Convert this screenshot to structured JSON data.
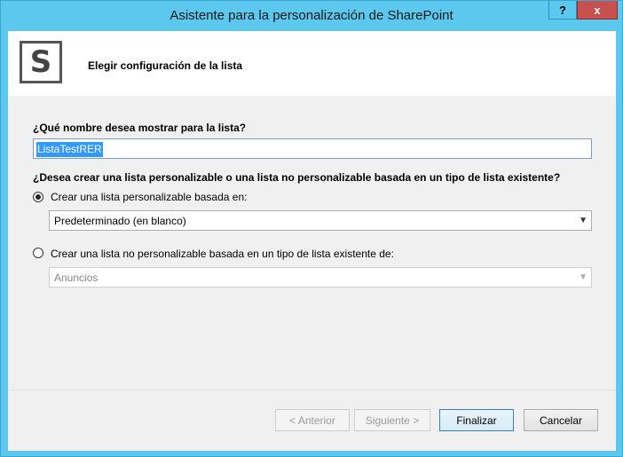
{
  "window": {
    "title": "Asistente para la personalización de SharePoint",
    "help_label": "?",
    "close_label": "x"
  },
  "header": {
    "logo_letter": "S",
    "title": "Elegir configuración de la lista"
  },
  "form": {
    "name_question": "¿Qué nombre desea mostrar para la lista?",
    "name_value": "ListaTestRER",
    "type_question": "¿Desea crear una lista personalizable o una lista no personalizable basada en un tipo de lista existente?",
    "option_custom": {
      "label": "Crear una lista personalizable basada en:",
      "checked": true,
      "select_value": "Predeterminado (en blanco)"
    },
    "option_noncustom": {
      "label": "Crear una lista no personalizable basada en un tipo de lista existente de:",
      "checked": false,
      "select_value": "Anuncios"
    }
  },
  "buttons": {
    "back": "< Anterior",
    "next": "Siguiente >",
    "finish": "Finalizar",
    "cancel": "Cancelar"
  },
  "icons": {
    "dropdown": "chevron-down-icon",
    "logo": "sharepoint-logo-icon"
  }
}
